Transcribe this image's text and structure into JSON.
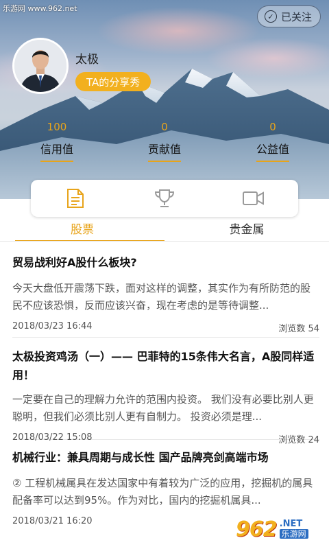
{
  "watermark": {
    "top": "乐游网 www.962.net",
    "logo_digits": "962",
    "logo_net": ".NET",
    "logo_cn": "乐游网"
  },
  "header": {
    "follow_label": "已关注",
    "user_name": "太极",
    "share_badge": "TA的分享秀",
    "stats": [
      {
        "value": "100",
        "label": "信用值"
      },
      {
        "value": "0",
        "label": "贡献值"
      },
      {
        "value": "0",
        "label": "公益值"
      }
    ]
  },
  "icons": [
    "document-icon",
    "trophy-icon",
    "video-icon"
  ],
  "tabs": [
    {
      "label": "股票",
      "active": true
    },
    {
      "label": "贵金属",
      "active": false
    }
  ],
  "articles": [
    {
      "title": "贸易战利好A股什么板块?",
      "excerpt": "今天大盘低开震荡下跌，面对这样的调整，其实作为有所防范的股民不应该恐惧，反而应该兴奋，现在考虑的是等待调整...",
      "date": "2018/03/23 16:44",
      "views": "浏览数 54"
    },
    {
      "title": "太极投资鸡汤（一）—— 巴菲特的15条伟大名言，A股同样适用！",
      "excerpt": "一定要在自己的理解力允许的范围内投资。 我们没有必要比别人更聪明，但我们必须比别人更有自制力。 投资必须是理...",
      "date": "2018/03/22 15:08",
      "views": "浏览数 24"
    },
    {
      "title": "机械行业：兼具周期与成长性 国产品牌亮剑高端市场",
      "excerpt": "② 工程机械属具在发达国家中有着较为广泛的应用，挖掘机的属具配备率可以达到95%。作为对比，国内的挖掘机属具...",
      "date": "2018/03/21 16:20",
      "views": ""
    }
  ],
  "colors": {
    "accent": "#e8a41b",
    "badge": "#f2b01e"
  }
}
